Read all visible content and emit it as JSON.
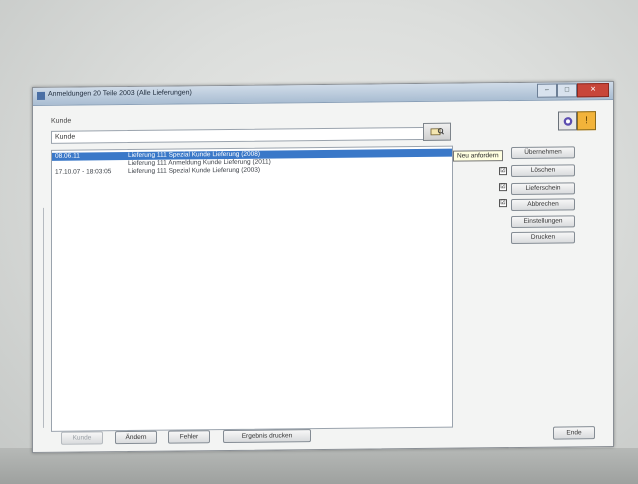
{
  "window": {
    "title": "Anmeldungen 20 Teile 2003 (Alle Lieferungen)",
    "controls": {
      "minimize": "–",
      "maximize": "□",
      "close": "✕"
    }
  },
  "filter": {
    "label": "Kunde",
    "value": "Kunde"
  },
  "tooltip": "Neu anfordern",
  "list": {
    "rows": [
      {
        "date": "08.06.11",
        "text": "Lieferung 111 Spezial Kunde Lieferung (2008)",
        "selected": true
      },
      {
        "date": "",
        "text": "Lieferung 111 Anmeldung Kunde Lieferung (2011)",
        "selected": false
      },
      {
        "date": "17.10.07 - 18:03:05",
        "text": "Lieferung 111 Spezial Kunde Lieferung (2003)",
        "selected": false
      }
    ]
  },
  "side_buttons": [
    "Übernehmen",
    "Löschen",
    "Lieferschein",
    "Abbrechen",
    "Einstellungen",
    "Drucken"
  ],
  "checkboxes": [
    "☑",
    "☑",
    "☑"
  ],
  "bottom_buttons": [
    {
      "label": "Kunde",
      "disabled": true
    },
    {
      "label": "Ändern",
      "disabled": false
    },
    {
      "label": "Fehler",
      "disabled": false
    },
    {
      "label": "Ergebnis drucken",
      "disabled": false
    },
    {
      "label": "Ende",
      "disabled": false
    }
  ],
  "icons": {
    "search": "search-icon",
    "ring": "settings-icon",
    "warning": "warning-icon"
  },
  "colors": {
    "selection": "#3a78c8",
    "close": "#c8463a",
    "warning": "#f2b33a"
  }
}
